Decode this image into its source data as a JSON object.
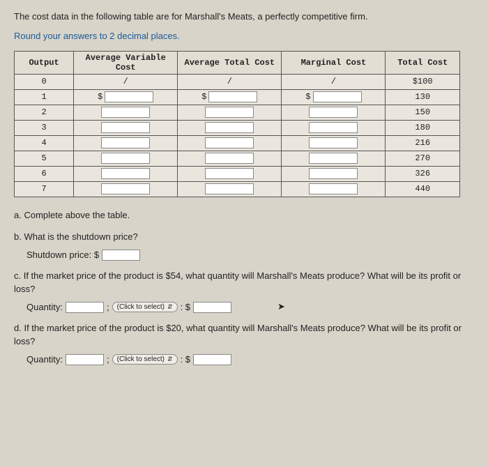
{
  "intro": "The cost data in the following table are for Marshall's Meats, a perfectly competitive firm.",
  "instruction": "Round your answers to 2 decimal places.",
  "table": {
    "headers": {
      "output": "Output",
      "avc": "Average Variable Cost",
      "atc": "Average Total Cost",
      "mc": "Marginal Cost",
      "tc": "Total Cost"
    },
    "rows": [
      {
        "output": "0",
        "avc": "/",
        "atc": "/",
        "mc": "/",
        "tc": "$100"
      },
      {
        "output": "1",
        "avc_prefix": "$",
        "atc_prefix": "$",
        "mc_prefix": "$",
        "tc": "130"
      },
      {
        "output": "2",
        "tc": "150"
      },
      {
        "output": "3",
        "tc": "180"
      },
      {
        "output": "4",
        "tc": "216"
      },
      {
        "output": "5",
        "tc": "270"
      },
      {
        "output": "6",
        "tc": "326"
      },
      {
        "output": "7",
        "tc": "440"
      }
    ]
  },
  "qa": {
    "a": "a. Complete above the table.",
    "b": "b. What is the shutdown price?",
    "b_label": "Shutdown price: $",
    "c": "c. If the market price of the product is $54, what quantity will Marshall's Meats produce? What will be its profit or loss?",
    "d": "d. If the market price of the product is $20, what quantity will Marshall's Meats produce? What will be its profit or loss?",
    "quantity_label": "Quantity:",
    "select_label": "(Click to select)",
    "colon_dollar": ": $",
    "semicolon": ";"
  }
}
